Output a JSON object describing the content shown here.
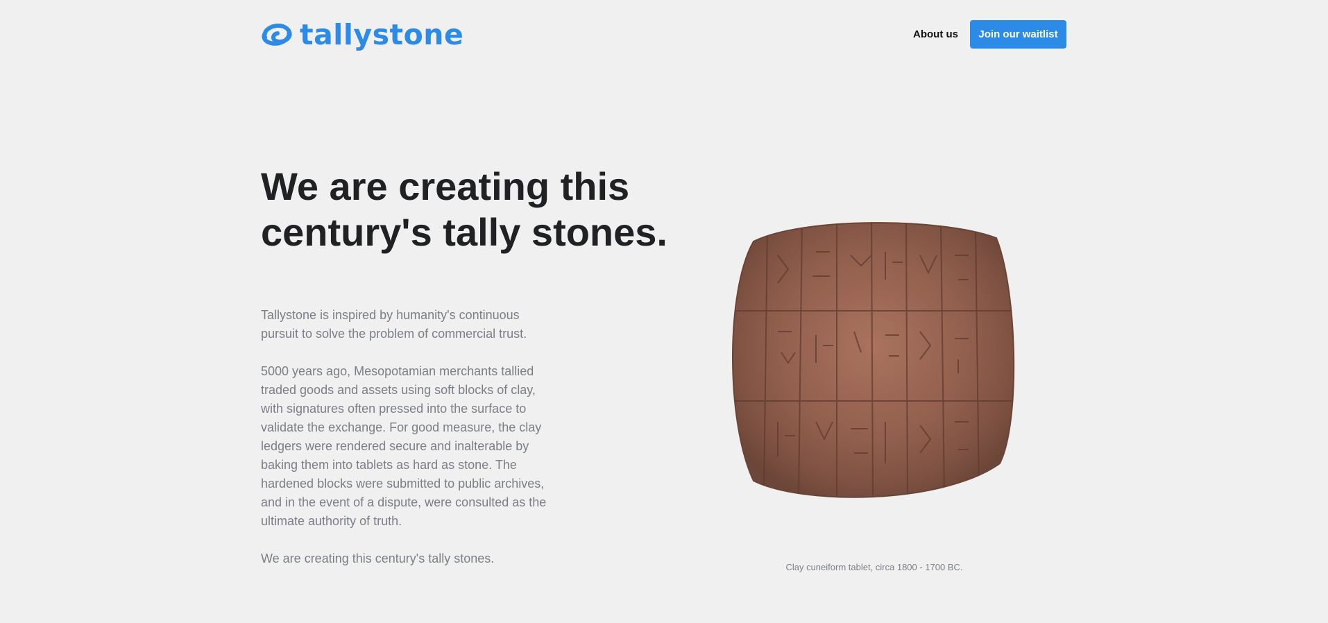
{
  "header": {
    "brand_name": "tallystone",
    "nav_about": "About us",
    "cta_label": "Join our waitlist"
  },
  "hero": {
    "headline_line1": "We are creating this",
    "headline_line2": "century's tally stones.",
    "paragraphs": [
      "Tallystone is inspired by humanity's continuous pursuit to solve the problem of commercial trust.",
      "5000 years ago, Mesopotamian merchants tallied traded goods and assets using soft blocks of clay, with signatures often pressed into the surface to validate the exchange. For good measure, the clay ledgers were rendered secure and inalterable by baking them into tablets as hard as stone. The hardened blocks were submitted to public archives, and in the event of a dispute, were consulted as the ultimate authority of truth.",
      "We are creating this century's tally stones."
    ]
  },
  "image": {
    "icon": "cuneiform-tablet-image",
    "caption": "Clay cuneiform tablet, circa 1800 - 1700 BC."
  },
  "colors": {
    "brand": "#2b8be6",
    "background": "#f0f0f0",
    "headline": "#202124",
    "body_text": "#7a7f86"
  }
}
